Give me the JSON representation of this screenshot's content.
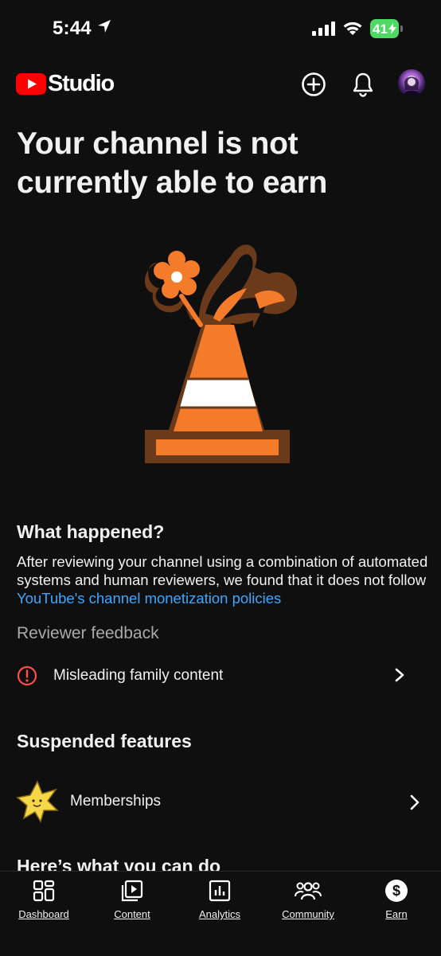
{
  "status_bar": {
    "time": "5:44",
    "battery": "41"
  },
  "header": {
    "logo_text": "Studio"
  },
  "main": {
    "title": "Your channel is not currently able to earn",
    "what_happened": {
      "heading": "What happened?",
      "text": "After reviewing your channel using a combination of automated systems and human reviewers, we found that it does not follow ",
      "link": "YouTube's channel monetization policies"
    },
    "feedback": {
      "heading": "Reviewer feedback",
      "items": [
        {
          "label": "Misleading family content"
        }
      ]
    },
    "suspended": {
      "heading": "Suspended features",
      "items": [
        {
          "label": "Memberships"
        }
      ]
    },
    "todo_heading": "Here’s what you can do"
  },
  "bottom_nav": {
    "items": [
      {
        "label": "Dashboard"
      },
      {
        "label": "Content"
      },
      {
        "label": "Analytics"
      },
      {
        "label": "Community"
      },
      {
        "label": "Earn"
      }
    ]
  },
  "colors": {
    "background": "#0f0f0f",
    "accent_red": "#ff0000",
    "link_blue": "#3ea6ff",
    "alert_red": "#ff4e45",
    "cone_orange": "#f47b2a",
    "cone_brown": "#6b3a1a",
    "star_yellow": "#f6d747"
  },
  "icons": [
    "location-arrow-icon",
    "signal-icon",
    "wifi-icon",
    "battery-icon",
    "youtube-logo-icon",
    "create-icon",
    "bell-icon",
    "alert-icon",
    "chevron-right-icon",
    "star-mascot-icon",
    "dashboard-icon",
    "content-icon",
    "analytics-icon",
    "community-icon",
    "earn-icon"
  ]
}
